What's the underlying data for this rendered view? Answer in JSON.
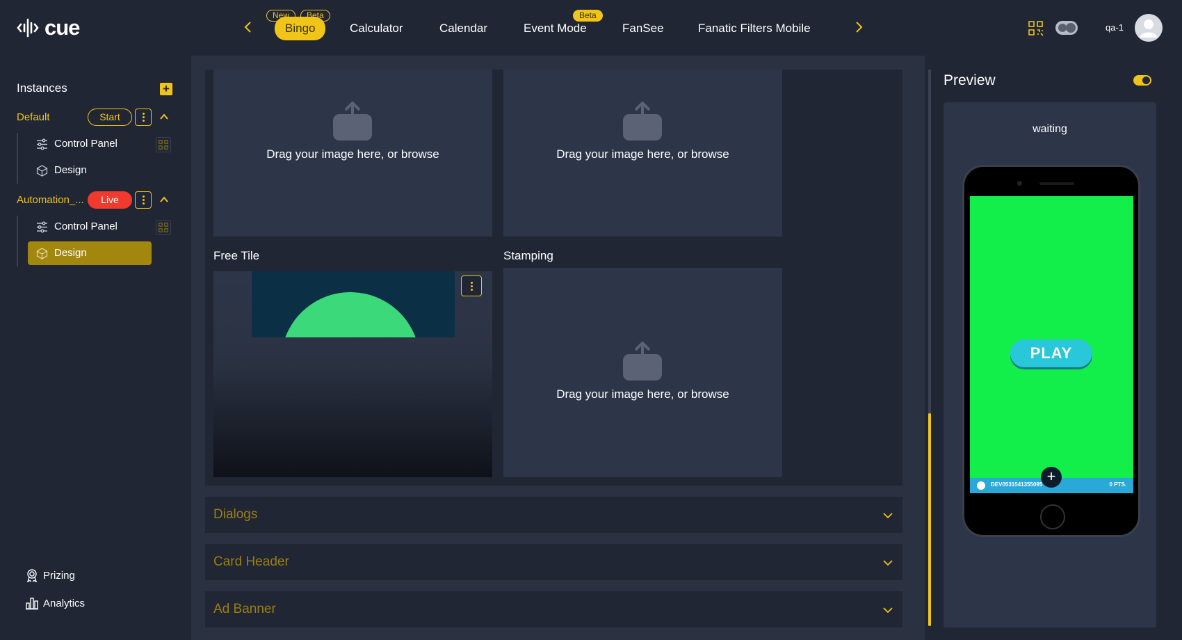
{
  "app": {
    "logo_text": "cue"
  },
  "tabs": [
    {
      "label": "Bingo",
      "active": true,
      "badges": [
        "New",
        "Beta"
      ]
    },
    {
      "label": "Calculator"
    },
    {
      "label": "Calendar"
    },
    {
      "label": "Event Mode",
      "badges": [
        "Beta"
      ]
    },
    {
      "label": "FanSee"
    },
    {
      "label": "Fanatic Filters Mobile"
    }
  ],
  "user": {
    "name": "qa-1"
  },
  "sidebar": {
    "title": "Instances",
    "instances": [
      {
        "name": "Default",
        "status": "Start",
        "items": [
          {
            "label": "Control Panel",
            "icon": "sliders-icon"
          },
          {
            "label": "Design",
            "icon": "cube-icon"
          }
        ]
      },
      {
        "name": "Automation_...",
        "status": "Live",
        "items": [
          {
            "label": "Control Panel",
            "icon": "sliders-icon"
          },
          {
            "label": "Design",
            "icon": "cube-icon",
            "active": true
          }
        ]
      }
    ],
    "bottom": [
      {
        "label": "Prizing",
        "icon": "award-icon"
      },
      {
        "label": "Analytics",
        "icon": "bar-chart-icon"
      }
    ]
  },
  "main": {
    "upload_text": "Drag your image here, or browse",
    "free_tile_label": "Free Tile",
    "stamping_label": "Stamping",
    "accordions": [
      "Dialogs",
      "Card Header",
      "Ad Banner"
    ]
  },
  "preview": {
    "title": "Preview",
    "status": "waiting",
    "play_label": "PLAY",
    "player_id": "DEV0531541355095",
    "points": "0 PTS."
  },
  "colors": {
    "accent": "#f0c419",
    "live": "#f03a2e",
    "background": "#202634",
    "panel": "#2d3649",
    "preview_screen": "#13ef4a",
    "play_button": "#28c7da"
  }
}
